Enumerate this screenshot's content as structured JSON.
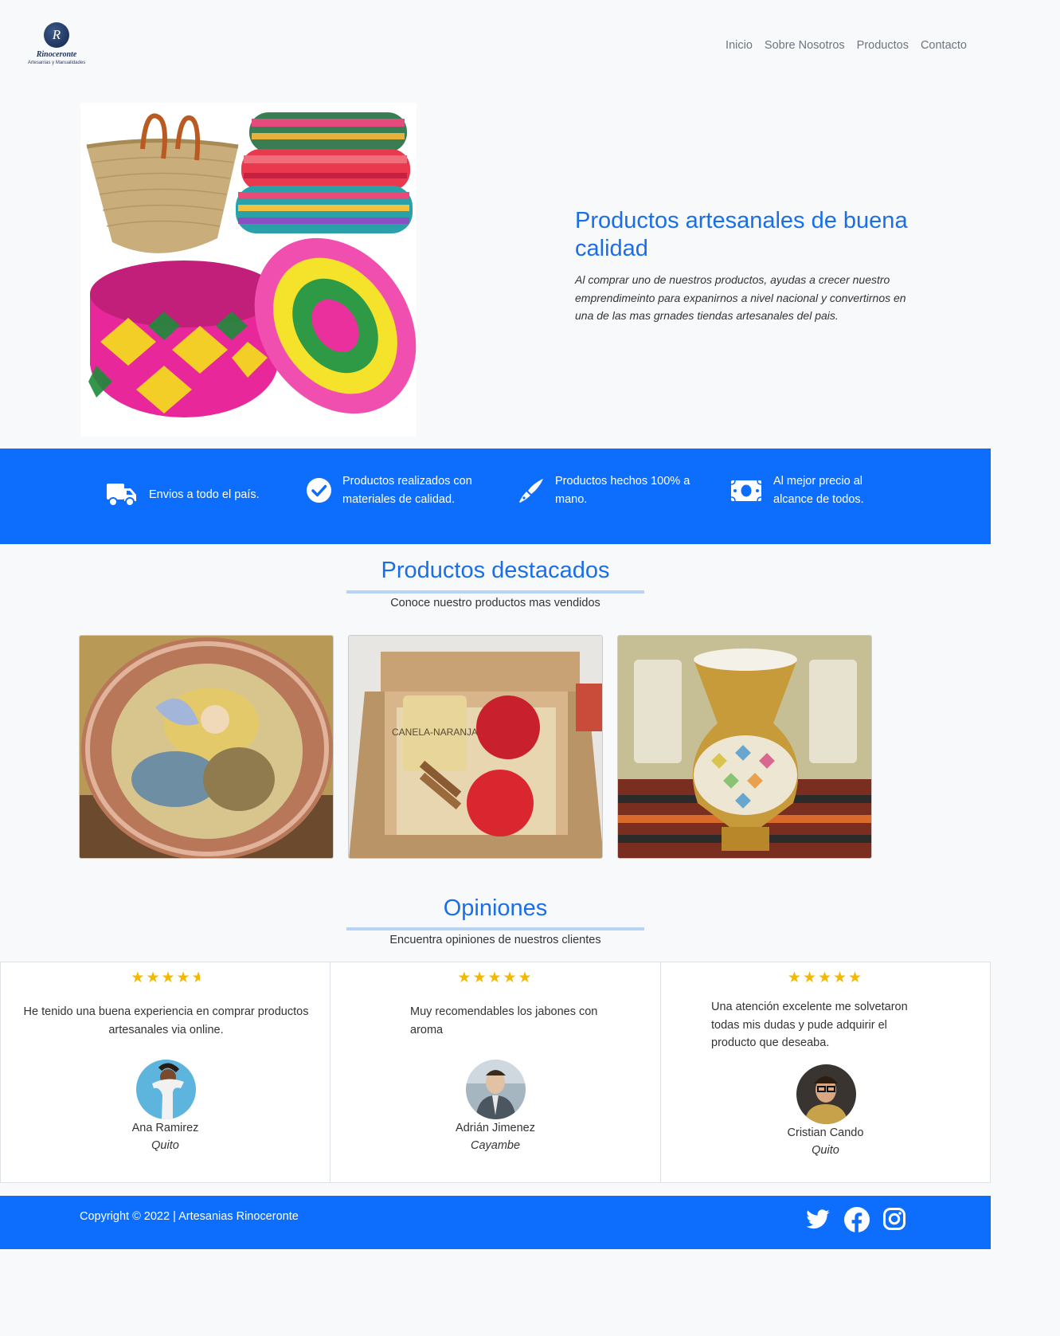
{
  "brand": {
    "logo_letter": "R",
    "name": "Rinoceronte",
    "tagline": "Artesanías y Manualidades"
  },
  "nav": {
    "items": [
      "Inicio",
      "Sobre Nosotros",
      "Productos",
      "Contacto"
    ]
  },
  "hero": {
    "title": "Productos artesanales de buena calidad",
    "description": "Al comprar uno de nuestros productos, ayudas a crecer nuestro emprendimeinto para expanirnos a nivel nacional y convertirnos en una de las mas grnades tiendas artesanales del pais."
  },
  "features": [
    {
      "icon": "truck-icon",
      "text": "Envios a todo el país."
    },
    {
      "icon": "check-circle-icon",
      "text": "Productos realizados con materiales de calidad."
    },
    {
      "icon": "pen-icon",
      "text": "Productos hechos 100% a mano."
    },
    {
      "icon": "money-icon",
      "text": "Al mejor precio al alcance de todos."
    }
  ],
  "featured": {
    "title": "Productos destacados",
    "subtitle": "Conoce nuestro productos mas vendidos",
    "products": [
      {
        "image": "painted-copper-plate"
      },
      {
        "image": "soap-gift-box",
        "box_label": "CANELA-NARANJA"
      },
      {
        "image": "mosaic-gold-vase"
      }
    ]
  },
  "opinions": {
    "title": "Opiniones",
    "subtitle": "Encuentra opiniones de nuestros clientes",
    "reviews": [
      {
        "rating": 4.5,
        "text": "He tenido una buena experiencia en comprar productos artesanales via online.",
        "name": "Ana Ramirez",
        "city": "Quito"
      },
      {
        "rating": 5,
        "text": "Muy recomendables los jabones con aroma",
        "name": "Adrián Jimenez",
        "city": "Cayambe"
      },
      {
        "rating": 5,
        "text": "Una atención excelente me solvetaron todas mis dudas y pude adquirir el producto que deseaba.",
        "name": "Cristian Cando",
        "city": "Quito"
      }
    ]
  },
  "footer": {
    "copyright": "Copyright © 2022 | Artesanias Rinoceronte",
    "social": [
      "twitter-icon",
      "facebook-icon",
      "instagram-icon"
    ]
  },
  "colors": {
    "primary": "#0d6efd",
    "heading": "#1a6fe8",
    "star": "#f5b800",
    "background": "#f8f9fa"
  }
}
